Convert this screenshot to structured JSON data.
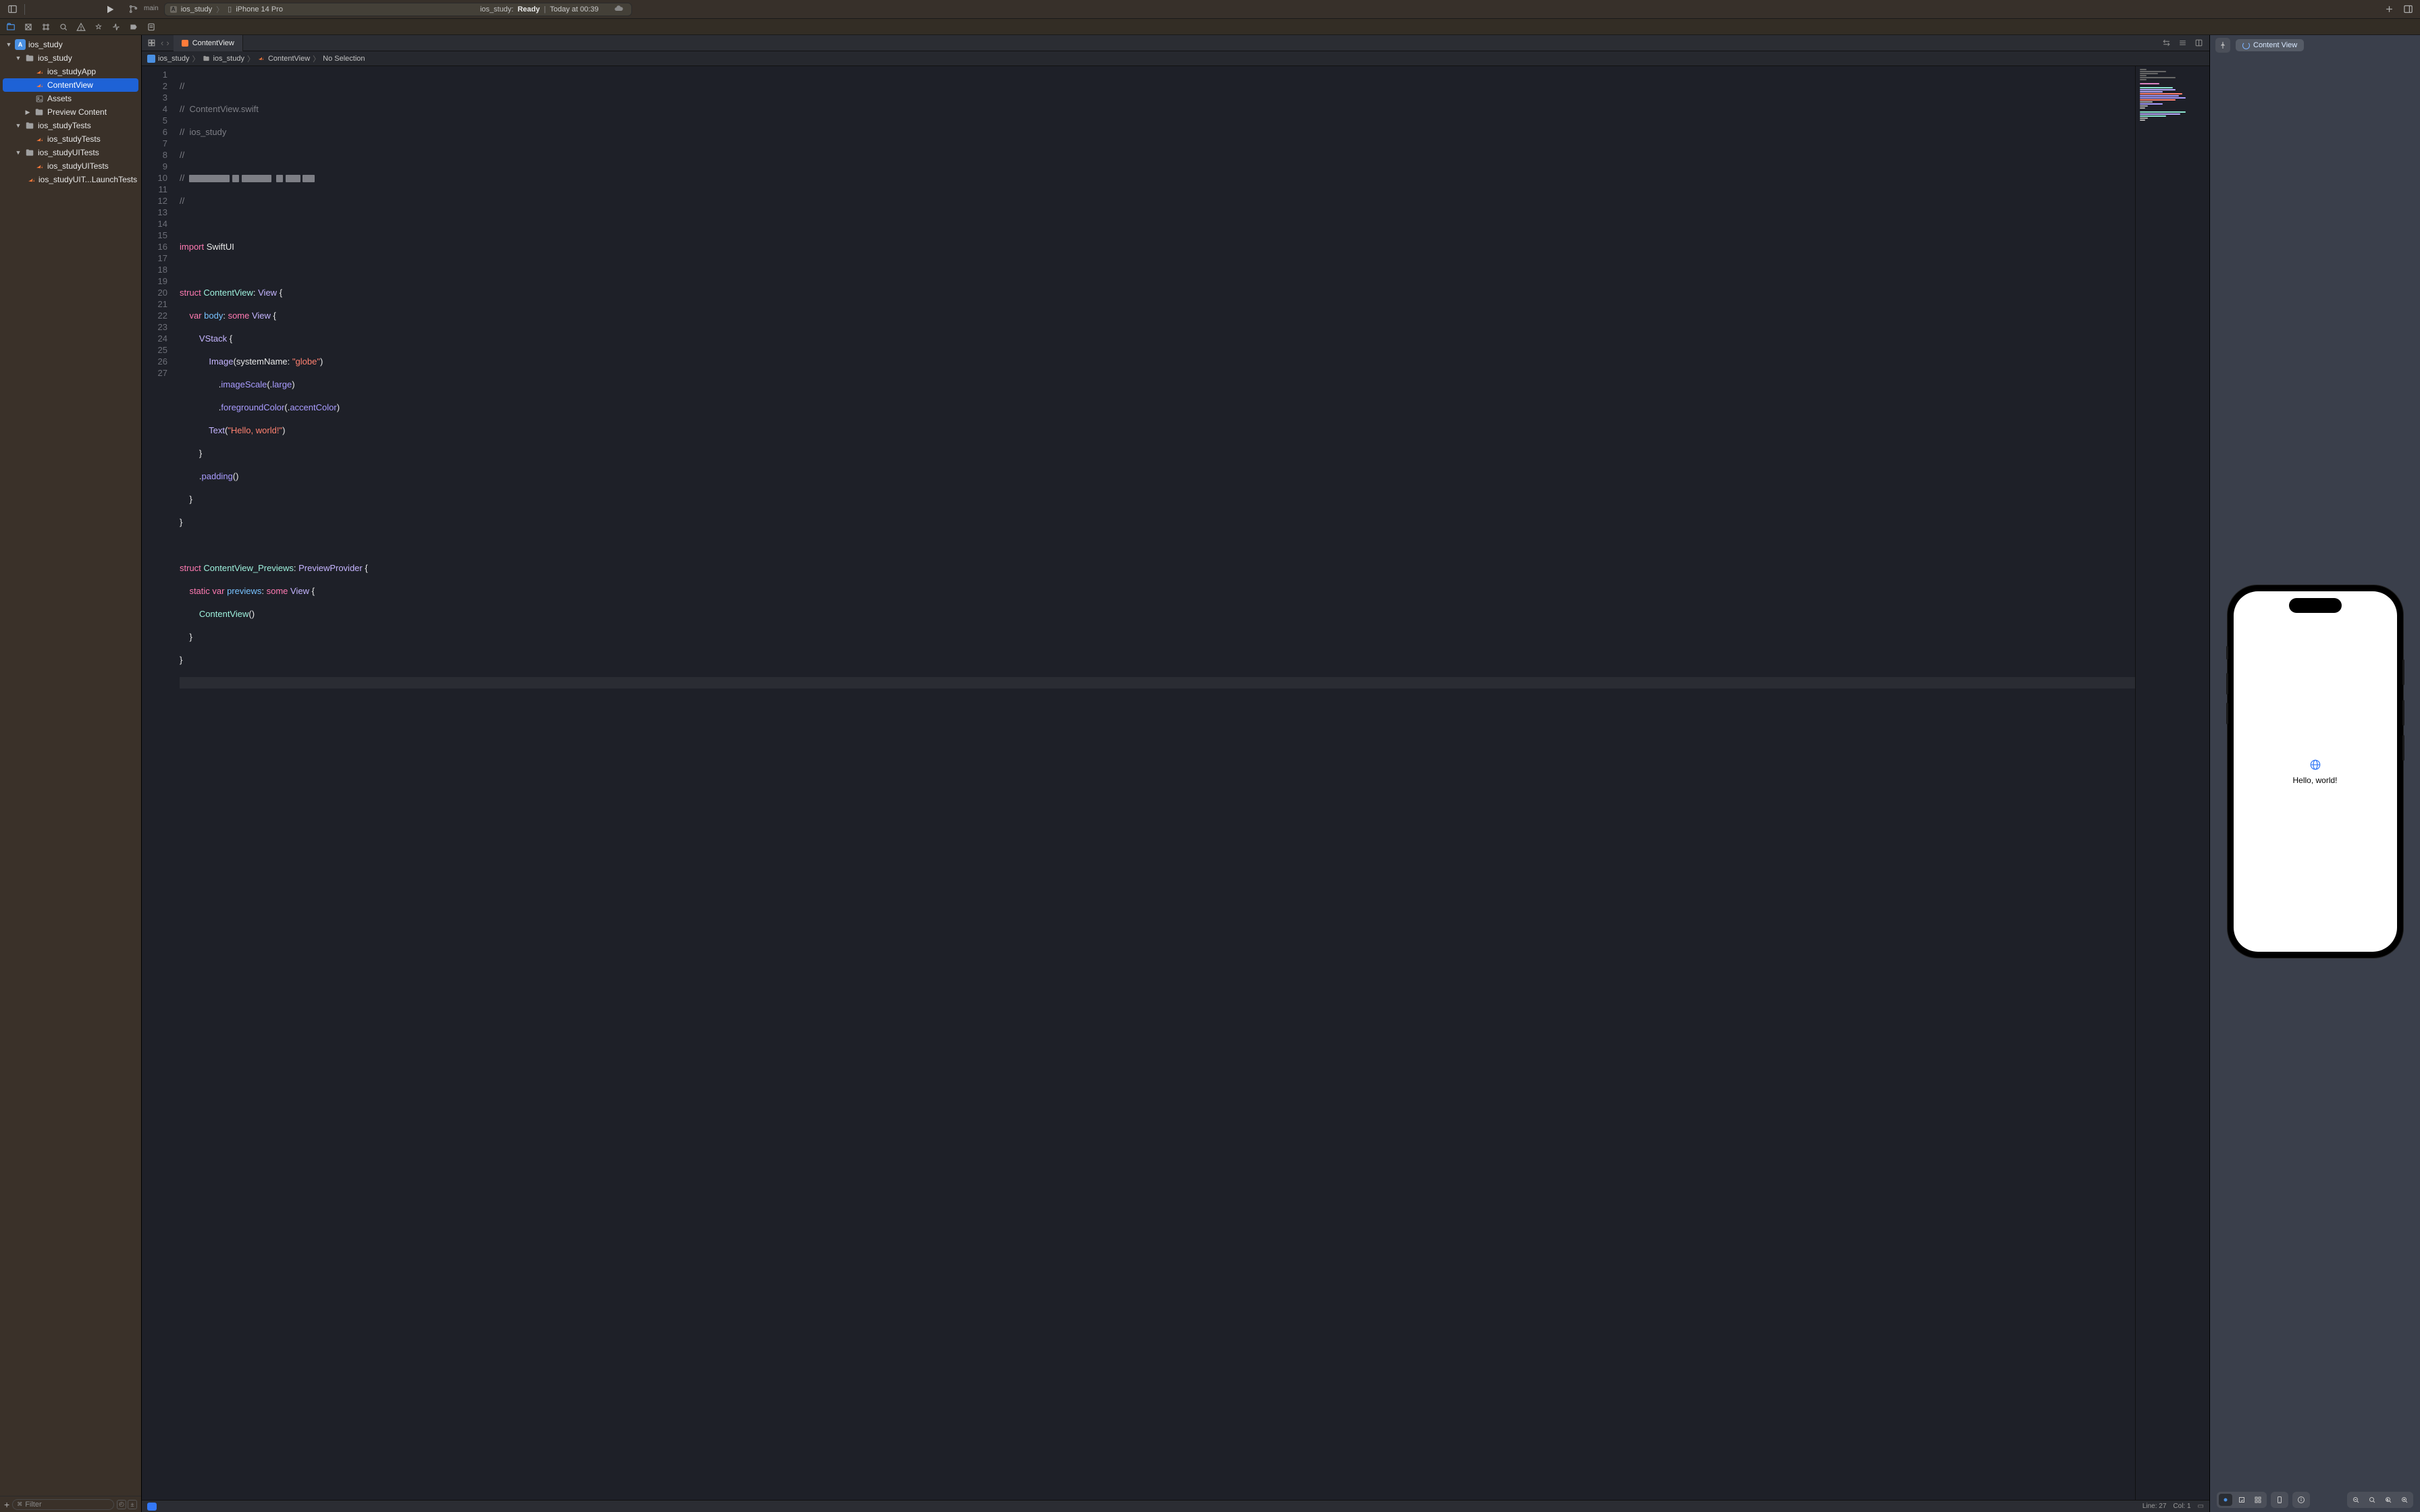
{
  "titlebar": {
    "scheme_name": "ios_study",
    "branch_name": "main",
    "activity_scheme": "ios_study",
    "activity_device": "iPhone 14 Pro",
    "status_prefix": "ios_study:",
    "status_ready": "Ready",
    "status_time": "Today at 00:39"
  },
  "navigator": {
    "tree": {
      "root": "ios_study",
      "group_app": "ios_study",
      "file_app": "ios_studyApp",
      "file_contentview": "ContentView",
      "file_assets": "Assets",
      "group_preview": "Preview Content",
      "group_tests": "ios_studyTests",
      "file_tests": "ios_studyTests",
      "group_uitests": "ios_studyUITests",
      "file_uitests": "ios_studyUITests",
      "file_launchtests": "ios_studyUIT...LaunchTests"
    },
    "filter_placeholder": "Filter"
  },
  "tabs": {
    "contentview": "ContentView"
  },
  "jumpbar": {
    "seg1": "ios_study",
    "seg2": "ios_study",
    "seg3": "ContentView",
    "seg4": "No Selection"
  },
  "code": {
    "l1": "//",
    "l2a": "//  ",
    "l2b": "ContentView.swift",
    "l3a": "//  ",
    "l3b": "ios_study",
    "l4": "//",
    "l5a": "//  ",
    "l6": "//",
    "l8a": "import",
    "l8b": " SwiftUI",
    "l10a": "struct",
    "l10b": " ContentView",
    "l10c": ": ",
    "l10d": "View",
    "l10e": " {",
    "l11a": "    var",
    "l11b": " body",
    "l11c": ": ",
    "l11d": "some",
    "l11e": " View",
    "l11f": " {",
    "l12a": "        VStack",
    "l12b": " {",
    "l13a": "            Image",
    "l13b": "(systemName: ",
    "l13c": "\"globe\"",
    "l13d": ")",
    "l14a": "                .",
    "l14b": "imageScale",
    "l14c": "(.",
    "l14d": "large",
    "l14e": ")",
    "l15a": "                .",
    "l15b": "foregroundColor",
    "l15c": "(.",
    "l15d": "accentColor",
    "l15e": ")",
    "l16a": "            Text",
    "l16b": "(",
    "l16c": "\"Hello, world!\"",
    "l16d": ")",
    "l17": "        }",
    "l18a": "        .",
    "l18b": "padding",
    "l18c": "()",
    "l19": "    }",
    "l20": "}",
    "l22a": "struct",
    "l22b": " ContentView_Previews",
    "l22c": ": ",
    "l22d": "PreviewProvider",
    "l22e": " {",
    "l23a": "    static",
    "l23b": " var",
    "l23c": " previews",
    "l23d": ": ",
    "l23e": "some",
    "l23f": " View",
    "l23g": " {",
    "l24a": "        ContentView",
    "l24b": "()",
    "l25": "    }",
    "l26": "}",
    "gutter": [
      "1",
      "2",
      "3",
      "4",
      "5",
      "6",
      "7",
      "8",
      "9",
      "10",
      "11",
      "12",
      "13",
      "14",
      "15",
      "16",
      "17",
      "18",
      "19",
      "20",
      "21",
      "22",
      "23",
      "24",
      "25",
      "26",
      "27"
    ]
  },
  "preview": {
    "pill_label": "Content View",
    "hello_text": "Hello, world!"
  },
  "statusbar": {
    "line": "Line: 27",
    "col": "Col: 1"
  }
}
